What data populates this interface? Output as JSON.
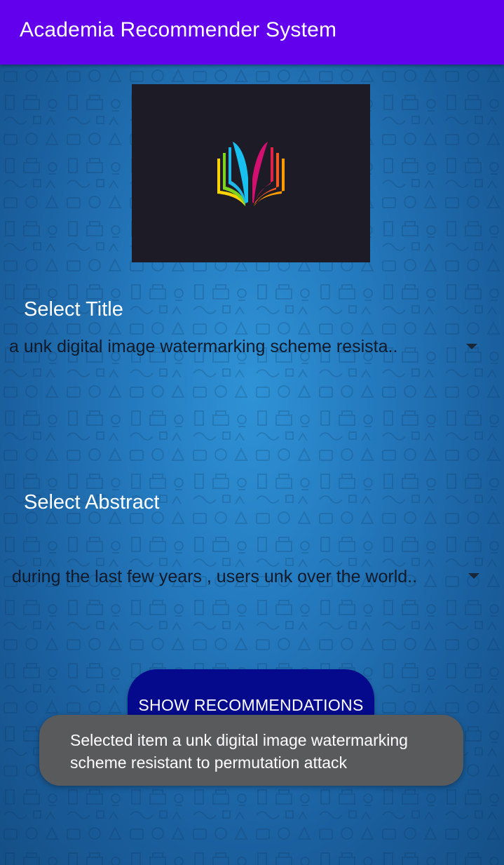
{
  "app_bar": {
    "title": "Academia Recommender System",
    "background_color": "#6200ee"
  },
  "logo": {
    "icon": "open-book-rainbow-logo",
    "background_color": "#1c1b26"
  },
  "title_section": {
    "label": "Select Title",
    "selected_value": "a unk digital image watermarking scheme resista..",
    "dropdown_icon": "dropdown-arrow-icon"
  },
  "abstract_section": {
    "label": "Select Abstract",
    "selected_value": "during the last few years , users unk over the world..",
    "dropdown_icon": "dropdown-arrow-icon"
  },
  "show_button": {
    "label": "SHOW RECOMMENDATIONS",
    "color": "#050a8c"
  },
  "toast": {
    "message": "Selected item a unk digital image watermarking scheme resistant to permutation attack"
  }
}
